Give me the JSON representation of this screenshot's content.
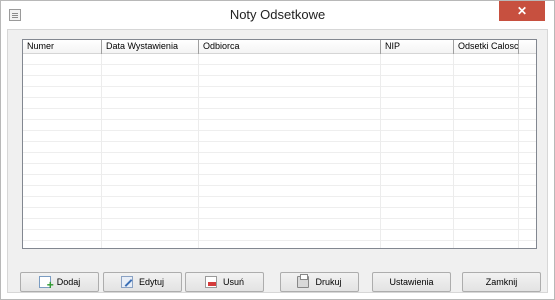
{
  "window": {
    "title": "Noty Odsetkowe",
    "close_glyph": "✕"
  },
  "table": {
    "columns": [
      "Numer",
      "Data Wystawienia",
      "Odbiorca",
      "NIP",
      "Odsetki Calosc"
    ],
    "rows": []
  },
  "buttons": {
    "add": "Dodaj",
    "edit": "Edytuj",
    "delete": "Usuń",
    "print": "Drukuj",
    "settings": "Ustawienia",
    "close": "Zamknij"
  }
}
